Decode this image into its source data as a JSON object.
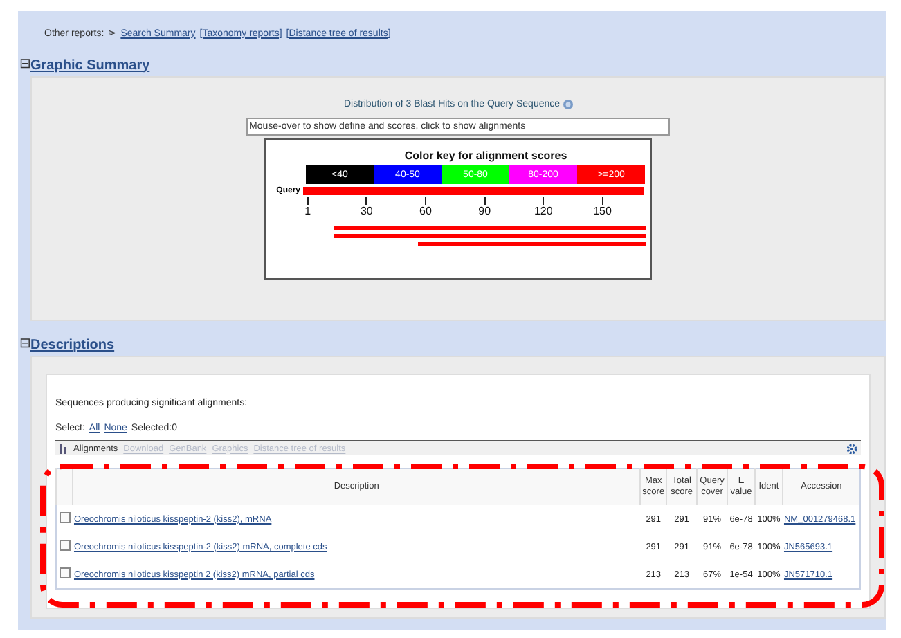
{
  "other_reports": {
    "label": "Other reports:",
    "marker": "⋗",
    "links": [
      "Search Summary",
      "[Taxonomy reports]",
      "[Distance tree of results]"
    ]
  },
  "graphic_summary": {
    "toggle": "⊟",
    "title": "Graphic Summary",
    "heading": "Distribution of 3 Blast Hits on the Query Sequence",
    "placeholder": "Mouse-over to show define and scores, click to show alignments",
    "color_key": {
      "title": "Color key for alignment scores",
      "ranges": [
        {
          "label": "<40",
          "color": "#000000"
        },
        {
          "label": "40-50",
          "color": "#0000ff"
        },
        {
          "label": "50-80",
          "color": "#00ff00"
        },
        {
          "label": "80-200",
          "color": "#ff00ff"
        },
        {
          "label": ">=200",
          "color": "#ff0000"
        }
      ]
    },
    "query_label": "Query",
    "ticks": [
      "1",
      "30",
      "60",
      "90",
      "120",
      "150"
    ]
  },
  "descriptions": {
    "toggle": "⊟",
    "title": "Descriptions",
    "subtitle": "Sequences producing significant alignments:",
    "select_label": "Select:",
    "select_links": [
      "All",
      "None"
    ],
    "selected_count": "Selected:0",
    "toolbar": [
      {
        "label": "Alignments",
        "disabled": false
      },
      {
        "label": "Download",
        "disabled": true
      },
      {
        "label": "GenBank",
        "disabled": true
      },
      {
        "label": "Graphics",
        "disabled": true
      },
      {
        "label": "Distance tree of results",
        "disabled": true
      }
    ],
    "table": {
      "columns": [
        "Description",
        "Max score",
        "Total score",
        "Query cover",
        "E value",
        "Ident",
        "Accession"
      ],
      "rows": [
        {
          "checked": false,
          "description": "Oreochromis niloticus kisspeptin-2 (kiss2), mRNA",
          "max_score": "291",
          "total_score": "291",
          "query_cover": "91%",
          "e_value": "6e-78",
          "ident": "100%",
          "accession": "NM_001279468.1"
        },
        {
          "checked": false,
          "description": "Oreochromis niloticus kisspeptin-2 (kiss2) mRNA, complete cds",
          "max_score": "291",
          "total_score": "291",
          "query_cover": "91%",
          "e_value": "6e-78",
          "ident": "100%",
          "accession": "JN565693.1"
        },
        {
          "checked": false,
          "description": "Oreochromis niloticus kisspeptin 2 (kiss2) mRNA, partial cds",
          "max_score": "213",
          "total_score": "213",
          "query_cover": "67%",
          "e_value": "1e-54",
          "ident": "100%",
          "accession": "JN571710.1"
        }
      ]
    }
  }
}
